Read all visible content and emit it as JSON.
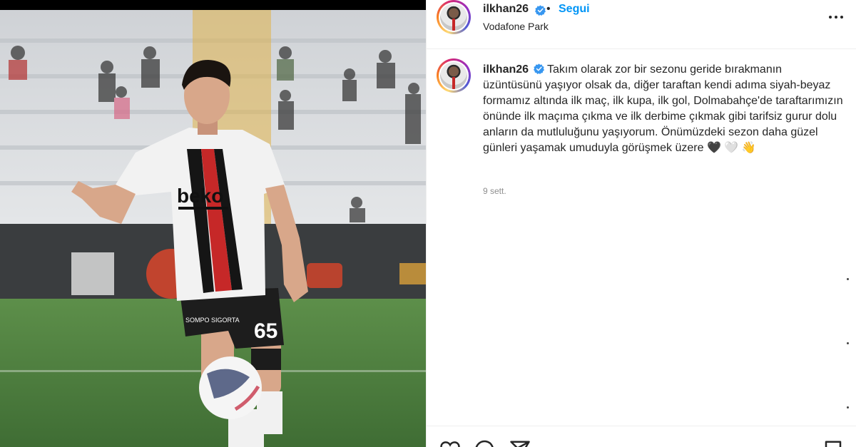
{
  "post": {
    "header": {
      "username": "ilkhan26",
      "separator": "•",
      "follow_label": "Segui",
      "location": "Vodafone Park"
    },
    "caption": {
      "username": "ilkhan26",
      "text": "Takım olarak zor bir sezonu geride bırakmanın üzüntüsünü yaşıyor olsak da, diğer taraftan kendi adıma siyah-beyaz formamız altında ilk maç, ilk kupa, ilk gol, Dolmabahçe'de taraftarımızın önünde ilk maçıma çıkma ve ilk derbime çıkmak gibi tarifsiz gurur dolu anların da mutluluğunu yaşıyorum. Önümüzdeki sezon daha güzel günleri yaşamak umuduyla görüşmek üzere",
      "emojis": [
        "🖤",
        "🤍",
        "👋"
      ]
    },
    "date": "9 sett.",
    "photo": {
      "jersey_brand": "beko",
      "jersey_number": "65",
      "shorts_sponsor": "SOMPO SIGORTA"
    },
    "icons": [
      "verified-icon",
      "more-options-icon",
      "like-icon",
      "comment-icon",
      "share-icon",
      "save-icon"
    ],
    "colors": {
      "follow": "#0095f6",
      "verified": "#3897f0",
      "date": "#8e8e8e"
    }
  }
}
